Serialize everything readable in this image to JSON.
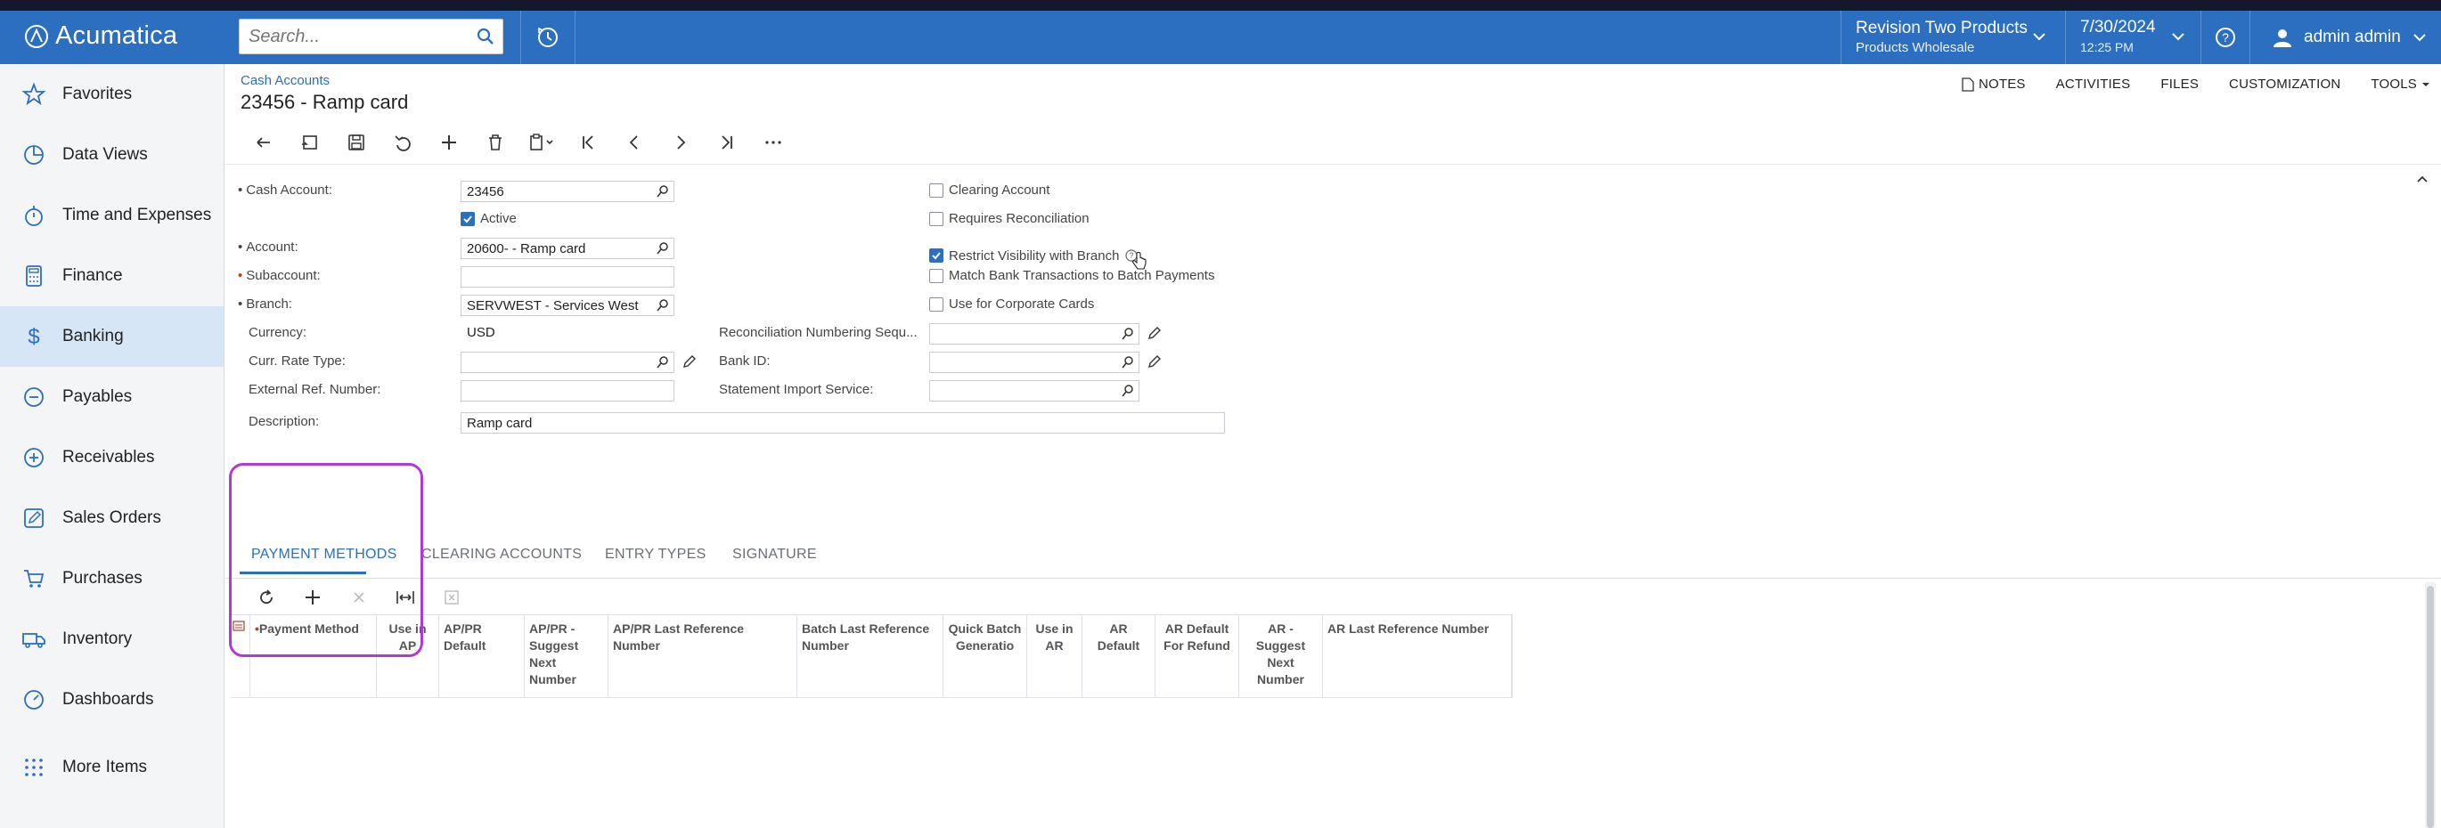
{
  "app": {
    "logo": "Acumatica"
  },
  "search": {
    "placeholder": "Search..."
  },
  "tenant": {
    "company": "Revision Two Products",
    "branch": "Products Wholesale"
  },
  "datetime": {
    "date": "7/30/2024",
    "time": "12:25 PM"
  },
  "user": {
    "name": "admin admin"
  },
  "sidebar": {
    "items": [
      {
        "label": "Favorites",
        "icon": "star-icon"
      },
      {
        "label": "Data Views",
        "icon": "pie-chart-icon"
      },
      {
        "label": "Time and Expenses",
        "icon": "stopwatch-icon"
      },
      {
        "label": "Finance",
        "icon": "calculator-icon"
      },
      {
        "label": "Banking",
        "icon": "dollar-icon"
      },
      {
        "label": "Payables",
        "icon": "minus-circle-icon"
      },
      {
        "label": "Receivables",
        "icon": "plus-circle-icon"
      },
      {
        "label": "Sales Orders",
        "icon": "pencil-box-icon"
      },
      {
        "label": "Purchases",
        "icon": "cart-icon"
      },
      {
        "label": "Inventory",
        "icon": "truck-icon"
      },
      {
        "label": "Dashboards",
        "icon": "gauge-icon"
      },
      {
        "label": "More Items",
        "icon": "grid-dots-icon"
      }
    ],
    "active": "Banking"
  },
  "page": {
    "breadcrumb": "Cash Accounts",
    "title": "23456 - Ramp card"
  },
  "header_tools": {
    "notes": "NOTES",
    "activities": "ACTIVITIES",
    "files": "FILES",
    "customization": "CUSTOMIZATION",
    "tools": "TOOLS"
  },
  "form": {
    "cash_account": {
      "label": "Cash Account:",
      "value": "23456"
    },
    "active": {
      "label": "Active",
      "checked": true
    },
    "account": {
      "label": "Account:",
      "value": "20600- - Ramp card"
    },
    "subaccount": {
      "label": "Subaccount:",
      "value": ""
    },
    "branch": {
      "label": "Branch:",
      "value": "SERVWEST - Services West"
    },
    "currency": {
      "label": "Currency:",
      "value": "USD"
    },
    "curr_rate_type": {
      "label": "Curr. Rate Type:",
      "value": ""
    },
    "external_ref": {
      "label": "External Ref. Number:",
      "value": ""
    },
    "description": {
      "label": "Description:",
      "value": "Ramp card"
    },
    "reconciliation_numbering": {
      "label": "Reconciliation Numbering Sequ...",
      "value": ""
    },
    "bank_id": {
      "label": "Bank ID:",
      "value": ""
    },
    "statement_import": {
      "label": "Statement Import Service:",
      "value": ""
    },
    "clearing_account": {
      "label": "Clearing Account",
      "checked": false
    },
    "requires_reconciliation": {
      "label": "Requires Reconciliation",
      "checked": false
    },
    "restrict_visibility": {
      "label": "Restrict Visibility with Branch",
      "checked": true
    },
    "match_bank": {
      "label": "Match Bank Transactions to Batch Payments",
      "checked": false
    },
    "corporate_cards": {
      "label": "Use for Corporate Cards",
      "checked": false
    }
  },
  "tabs": [
    {
      "label": "PAYMENT METHODS",
      "active": true
    },
    {
      "label": "CLEARING ACCOUNTS",
      "active": false
    },
    {
      "label": "ENTRY TYPES",
      "active": false
    },
    {
      "label": "SIGNATURE",
      "active": false
    }
  ],
  "grid": {
    "columns": [
      {
        "label": "Payment Method",
        "required": true
      },
      {
        "label": "Use in AP"
      },
      {
        "label": "AP/PR Default"
      },
      {
        "label": "AP/PR - Suggest Next Number"
      },
      {
        "label": "AP/PR Last Reference Number"
      },
      {
        "label": "Batch Last Reference Number"
      },
      {
        "label": "Quick Batch Generatio"
      },
      {
        "label": "Use in AR"
      },
      {
        "label": "AR Default"
      },
      {
        "label": "AR Default For Refund"
      },
      {
        "label": "AR - Suggest Next Number"
      },
      {
        "label": "AR Last Reference Number"
      }
    ]
  },
  "colors": {
    "header_bg": "#2c6ebf",
    "accent": "#2c6ebf",
    "highlight": "#b13ad6",
    "sidebar_active": "#d6e6f6"
  }
}
